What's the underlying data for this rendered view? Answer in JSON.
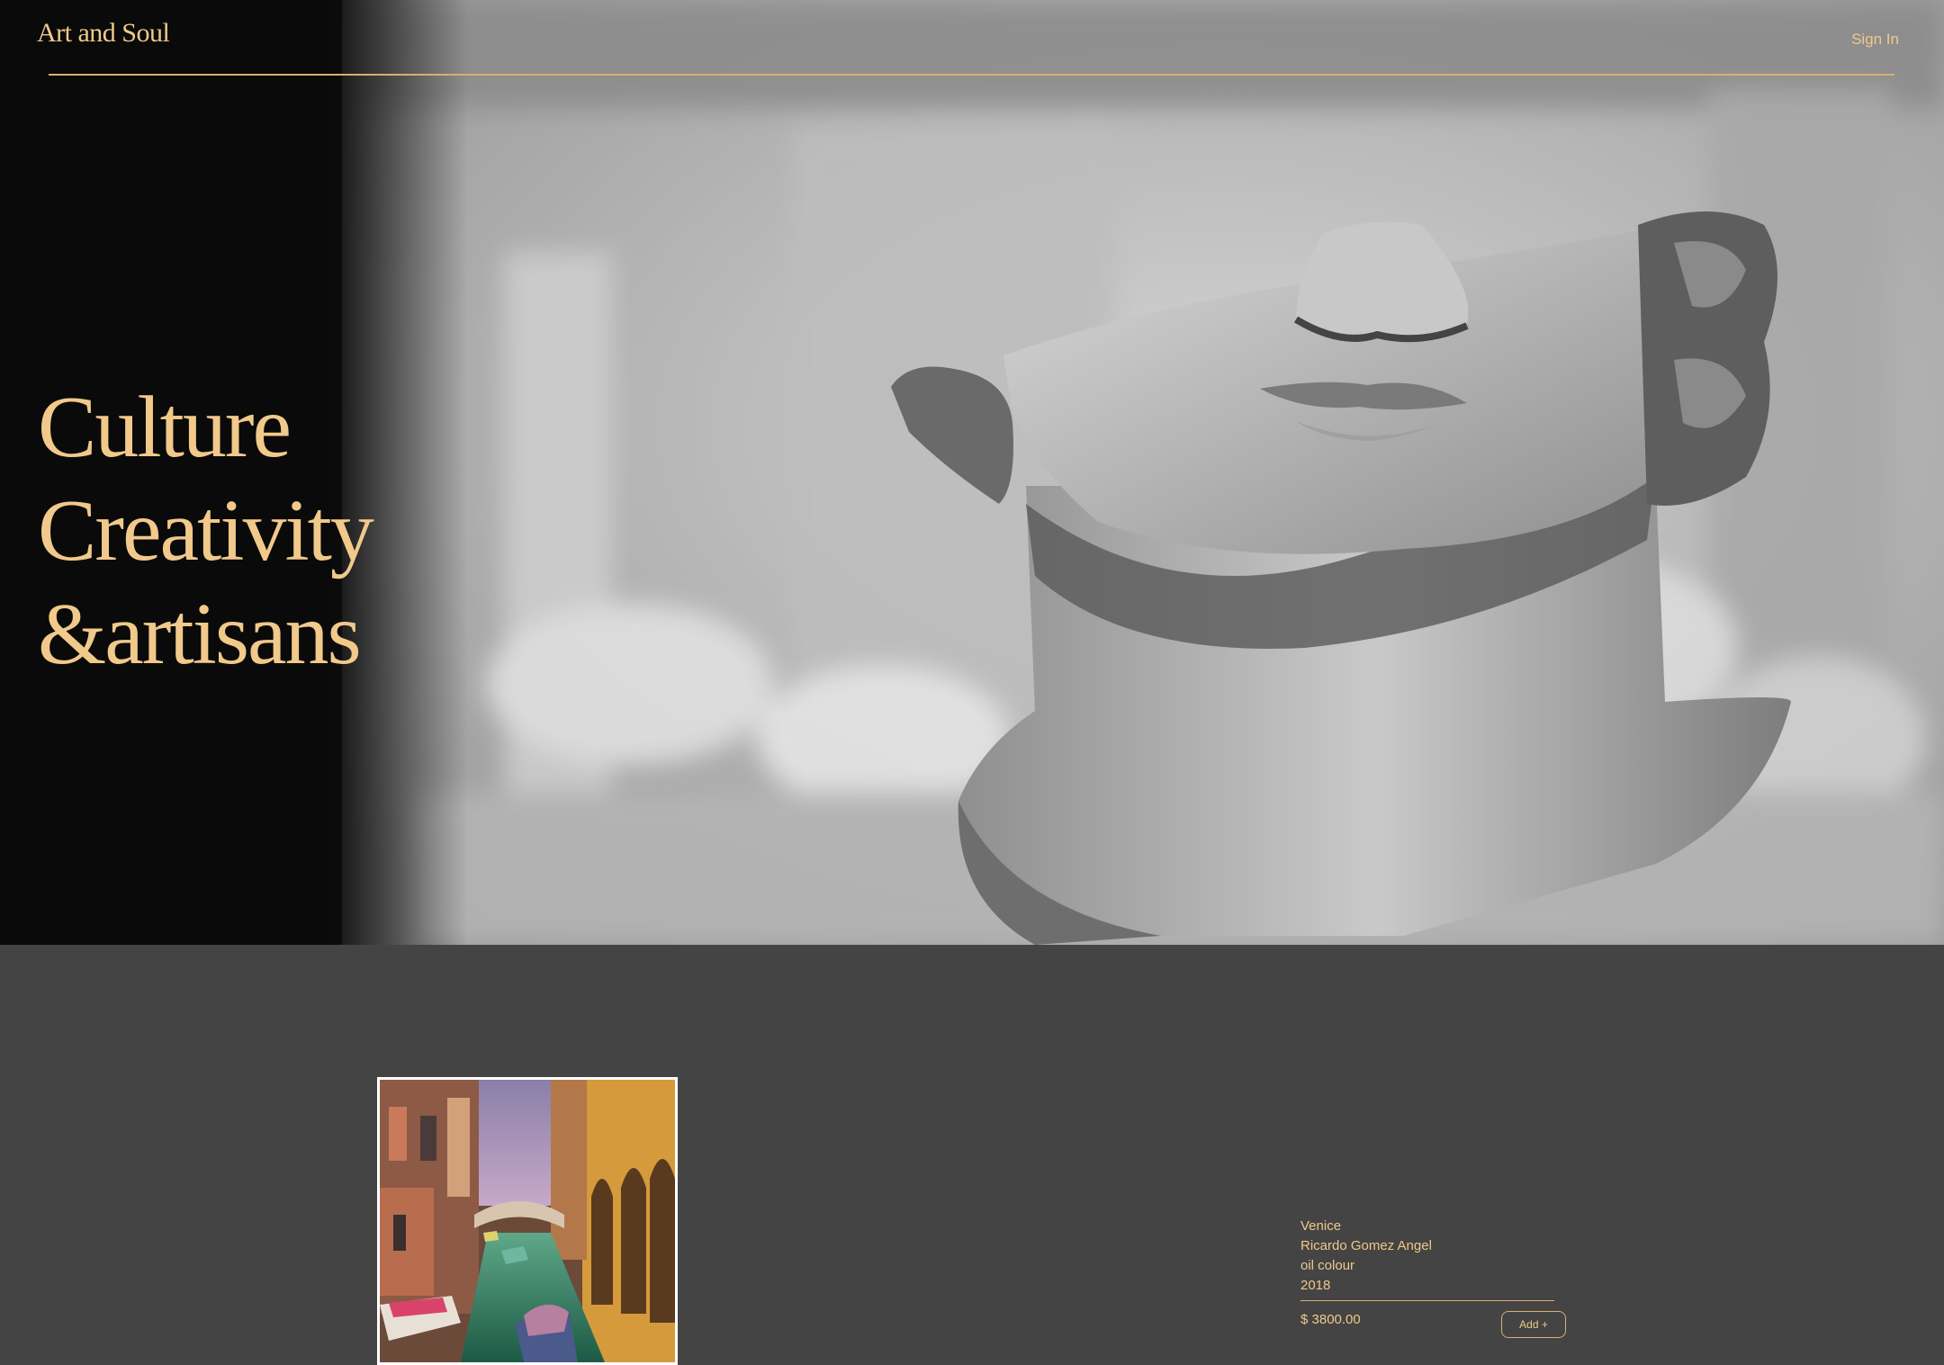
{
  "header": {
    "logo": "Art and Soul",
    "sign_in": "Sign In"
  },
  "hero": {
    "headline": [
      "Culture",
      "Creativity",
      "&artisans"
    ],
    "image": "marble-statue-head"
  },
  "artwork": {
    "title": "Venice",
    "artist": "Ricardo Gomez Angel",
    "medium": "oil colour",
    "year": "2018",
    "price": "$ 3800.00",
    "add_label": "Add +",
    "image": "venice-canal-painting"
  },
  "colors": {
    "accent": "#efc98a",
    "page_background": "#444444",
    "hero_dark": "#0e0e0e"
  }
}
